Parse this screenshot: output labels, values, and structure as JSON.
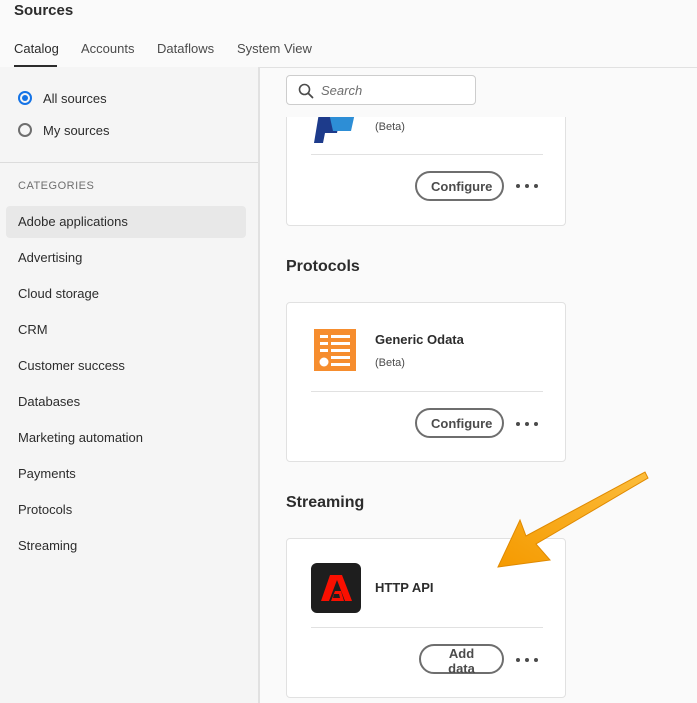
{
  "header": {
    "title": "Sources"
  },
  "tabs": [
    {
      "label": "Catalog",
      "active": true
    },
    {
      "label": "Accounts"
    },
    {
      "label": "Dataflows"
    },
    {
      "label": "System View"
    }
  ],
  "sidebar": {
    "filters": [
      {
        "label": "All sources",
        "checked": true
      },
      {
        "label": "My sources",
        "checked": false
      }
    ],
    "categories_heading": "CATEGORIES",
    "categories": [
      {
        "label": "Adobe applications",
        "selected": true
      },
      {
        "label": "Advertising"
      },
      {
        "label": "Cloud storage"
      },
      {
        "label": "CRM"
      },
      {
        "label": "Customer success"
      },
      {
        "label": "Databases"
      },
      {
        "label": "Marketing automation"
      },
      {
        "label": "Payments"
      },
      {
        "label": "Protocols"
      },
      {
        "label": "Streaming"
      }
    ]
  },
  "search": {
    "placeholder": "Search"
  },
  "sections": {
    "payments_card": {
      "badge": "(Beta)",
      "button": "Configure",
      "icon": "payment-logo-icon"
    },
    "protocols": {
      "title": "Protocols",
      "card": {
        "name": "Generic Odata",
        "badge": "(Beta)",
        "button": "Configure",
        "icon": "odata-logo-icon"
      }
    },
    "streaming": {
      "title": "Streaming",
      "card": {
        "name": "HTTP API",
        "button": "Add data",
        "icon": "adobe-logo-icon"
      }
    }
  },
  "colors": {
    "accent_blue": "#1473e6",
    "odata_orange": "#f68d2e",
    "adobe_red": "#fa0f00",
    "arrow_orange": "#f5a00f"
  }
}
